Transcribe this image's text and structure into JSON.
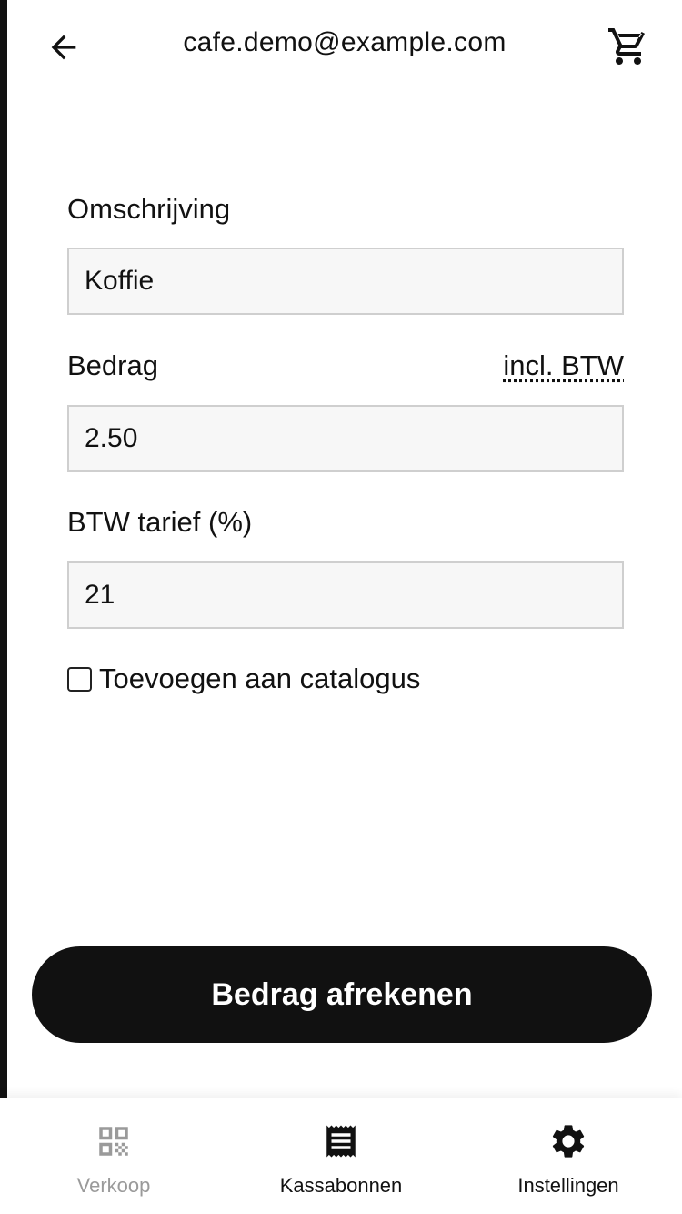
{
  "header": {
    "title": "cafe.demo@example.com",
    "back_icon": "arrow-left-icon",
    "cart_icon": "cart-icon"
  },
  "form": {
    "description_label": "Omschrijving",
    "description_value": "Koffie",
    "amount_label": "Bedrag",
    "amount_tax_mode": "incl. BTW",
    "amount_value": "2.50",
    "vat_label": "BTW tarief (%)",
    "vat_value": "21",
    "catalog_checkbox_label": "Toevoegen aan catalogus",
    "catalog_checked": false
  },
  "pay_button": {
    "label": "Bedrag afrekenen"
  },
  "tabbar": {
    "tabs": [
      {
        "label": "Verkoop",
        "icon": "qr-code-icon",
        "state": "inactive"
      },
      {
        "label": "Kassabonnen",
        "icon": "receipt-icon",
        "state": "active"
      },
      {
        "label": "Instellingen",
        "icon": "gear-icon",
        "state": "active"
      }
    ]
  },
  "colors": {
    "primary": "#111111",
    "inactive": "#9a9a9a",
    "input_bg": "#f7f7f7",
    "input_border": "#cfcfcf"
  }
}
